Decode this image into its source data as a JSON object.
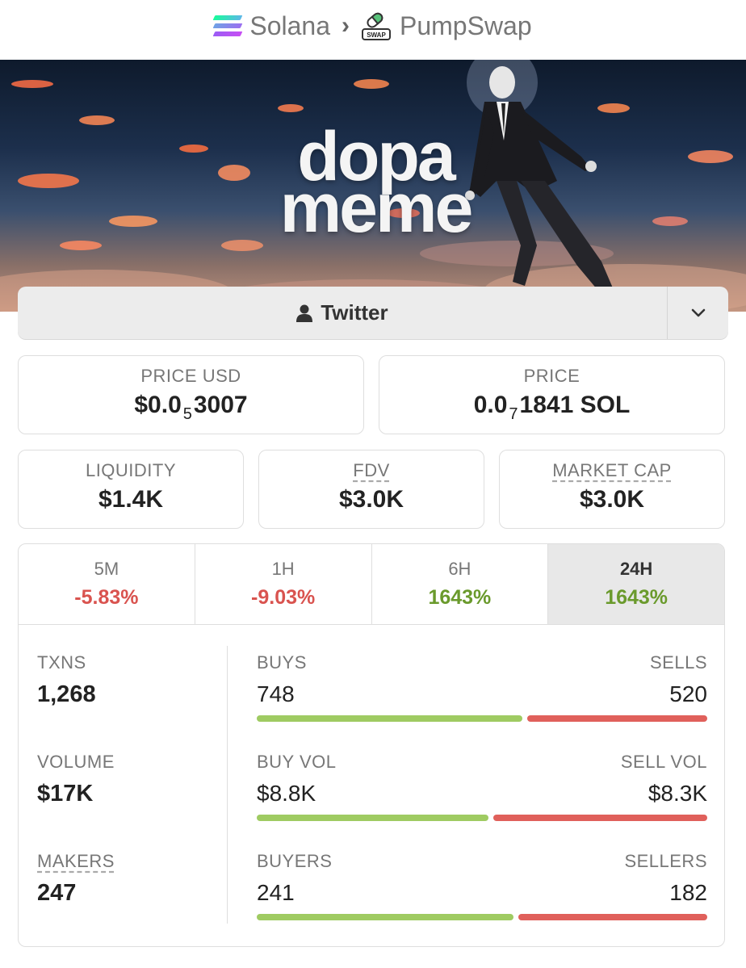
{
  "breadcrumb": {
    "chain": "Solana",
    "separator": "›",
    "dex": "PumpSwap",
    "dex_icon_text": "SWAP"
  },
  "banner": {
    "logo_line1": "dopa",
    "logo_line2": "meme"
  },
  "social": {
    "twitter_label": "Twitter"
  },
  "price_usd": {
    "label": "PRICE USD",
    "prefix": "$0.0",
    "zeros": "5",
    "digits": "3007"
  },
  "price_native": {
    "label": "PRICE",
    "prefix": "0.0",
    "zeros": "7",
    "digits": "1841 SOL"
  },
  "liquidity": {
    "label": "LIQUIDITY",
    "value": "$1.4K"
  },
  "fdv": {
    "label": "FDV",
    "value": "$3.0K"
  },
  "market_cap": {
    "label": "MARKET CAP",
    "value": "$3.0K"
  },
  "timeframes": [
    {
      "label": "5M",
      "change": "-5.83%",
      "direction": "down"
    },
    {
      "label": "1H",
      "change": "-9.03%",
      "direction": "down"
    },
    {
      "label": "6H",
      "change": "1643%",
      "direction": "up"
    },
    {
      "label": "24H",
      "change": "1643%",
      "direction": "up",
      "active": true
    }
  ],
  "txns": {
    "label": "TXNS",
    "value": "1,268"
  },
  "volume": {
    "label": "VOLUME",
    "value": "$17K"
  },
  "makers": {
    "label": "MAKERS",
    "value": "247"
  },
  "buys_sells": {
    "left_label": "BUYS",
    "left_value": "748",
    "right_label": "SELLS",
    "right_value": "520"
  },
  "vol_split": {
    "left_label": "BUY VOL",
    "left_value": "$8.8K",
    "right_label": "SELL VOL",
    "right_value": "$8.3K"
  },
  "participants": {
    "left_label": "BUYERS",
    "left_value": "241",
    "right_label": "SELLERS",
    "right_value": "182"
  },
  "colors": {
    "positive": "#6a9a2c",
    "negative": "#d9534f",
    "buy_bar": "#9fcb62",
    "sell_bar": "#e0605b"
  },
  "icons": [
    "solana-icon",
    "chevron-right-icon",
    "pumpswap-icon",
    "user-icon",
    "chevron-down-icon"
  ]
}
